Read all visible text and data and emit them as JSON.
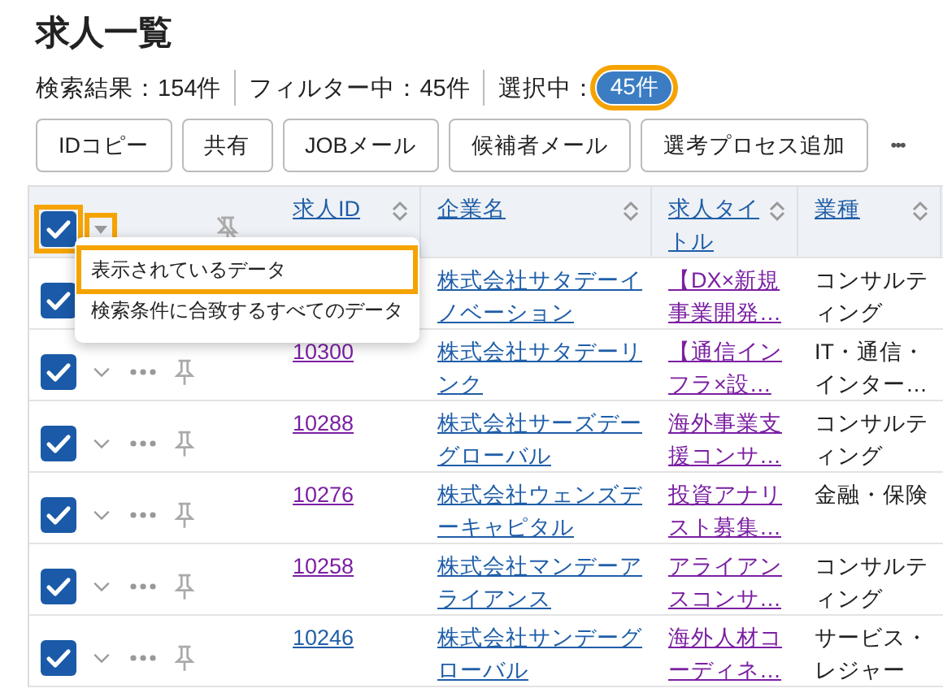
{
  "title": "求人一覧",
  "stats": [
    {
      "text": "検索結果：154件"
    },
    {
      "text": "フィルター中：45件"
    }
  ],
  "selection": {
    "label": "選択中：",
    "count": "45件",
    "highlighted": true
  },
  "actions": [
    {
      "label": "IDコピー"
    },
    {
      "label": "共有"
    },
    {
      "label": "JOBメール"
    },
    {
      "label": "候補者メール"
    },
    {
      "label": "選考プロセス追加"
    }
  ],
  "more_button": "•••",
  "table": {
    "select_all": {
      "checked": true,
      "highlighted": true
    },
    "select_menu_caret": {
      "highlighted": true
    },
    "columns": [
      {
        "label": "求人ID"
      },
      {
        "label": "企業名"
      },
      {
        "label": "求人タイトル"
      },
      {
        "label": "業種"
      }
    ],
    "rows": [
      {
        "checked": true,
        "id": null,
        "company": "株式会社サタデーイノベーション",
        "job_title": "【DX×新規事業開発…",
        "job_visited": true,
        "industry": "コンサルティング"
      },
      {
        "checked": true,
        "id": "10300",
        "id_visited": true,
        "company": "株式会社サタデーリンク",
        "job_title": "【通信インフラ×設…",
        "job_visited": true,
        "industry": "IT・通信・インター…"
      },
      {
        "checked": true,
        "id": "10288",
        "id_visited": true,
        "company": "株式会社サーズデーグローバル",
        "job_title": "海外事業支援コンサ…",
        "job_visited": true,
        "industry": "コンサルティング"
      },
      {
        "checked": true,
        "id": "10276",
        "id_visited": true,
        "company": "株式会社ウェンズデーキャピタル",
        "job_title": "投資アナリスト募集…",
        "job_visited": true,
        "industry": "金融・保険"
      },
      {
        "checked": true,
        "id": "10258",
        "id_visited": true,
        "company": "株式会社マンデーアライアンス",
        "job_title": "アライアンスコンサ…",
        "job_visited": true,
        "industry": "コンサルティング"
      },
      {
        "checked": true,
        "id": "10246",
        "id_visited": false,
        "company": "株式会社サンデーグローバル",
        "job_title": "海外人材コーディネ…",
        "job_visited": true,
        "industry": "サービス・レジャー"
      }
    ]
  },
  "select_menu": {
    "items": [
      {
        "label": "表示されているデータ",
        "highlighted": true
      },
      {
        "label": "検索条件に合致するすべてのデータ",
        "highlighted": false
      }
    ]
  }
}
